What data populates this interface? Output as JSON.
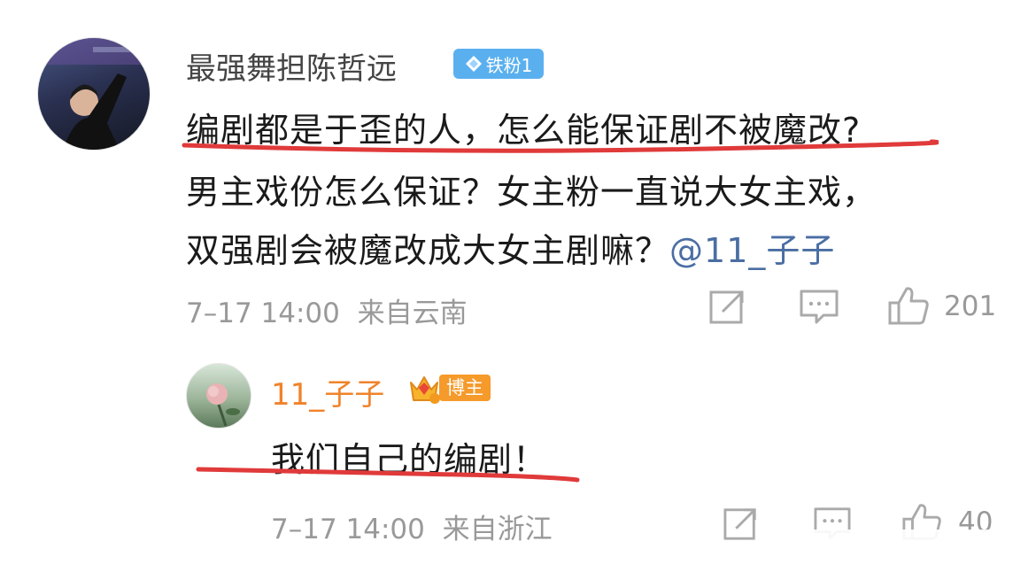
{
  "comment": {
    "username": "最强舞担陈哲远",
    "badge": "铁粉1",
    "lines": [
      "编剧都是于歪的人，怎么能保证剧不被魔改?",
      "男主戏份怎么保证？女主粉一直说大女主戏，",
      "双强剧会被魔改成大女主剧嘛？"
    ],
    "mention": "@11_子子",
    "time": "7–17 14:00",
    "location": "来自云南",
    "likes": "201",
    "underline_color": "#e03a3a"
  },
  "reply": {
    "username": "11_子子",
    "badge": "博主",
    "text": "我们自己的编剧！",
    "time": "7–17 14:00",
    "location": "来自浙江",
    "likes": "40",
    "name_color": "#f0832a"
  },
  "icons": [
    "share-icon",
    "comment-icon",
    "like-icon",
    "crown-icon",
    "diamond-icon"
  ]
}
